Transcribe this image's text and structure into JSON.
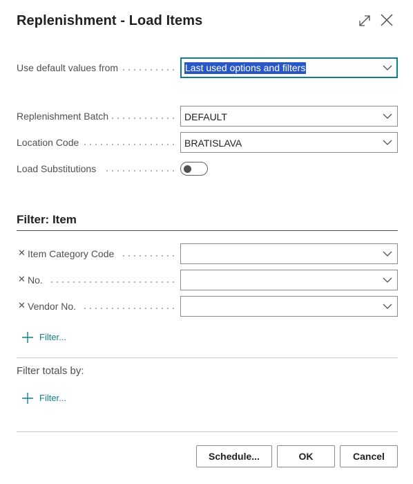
{
  "dialog": {
    "title": "Replenishment - Load Items",
    "expand_icon": "expand-diagonal-icon",
    "close_icon": "close-icon"
  },
  "options": {
    "default_values": {
      "label": "Use default values from",
      "value": "Last used options and filters"
    },
    "batch": {
      "label": "Replenishment Batch",
      "value": "DEFAULT"
    },
    "location": {
      "label": "Location Code",
      "value": "BRATISLAVA"
    },
    "substitutions": {
      "label": "Load Substitutions",
      "enabled": false
    }
  },
  "item_filter": {
    "title": "Filter: Item",
    "fields": [
      {
        "label": "Item Category Code",
        "value": ""
      },
      {
        "label": "No.",
        "value": ""
      },
      {
        "label": "Vendor No.",
        "value": ""
      }
    ],
    "add_filter_label": "Filter..."
  },
  "filter_totals": {
    "title": "Filter totals by:",
    "add_filter_label": "Filter..."
  },
  "footer": {
    "schedule_label": "Schedule...",
    "ok_label": "OK",
    "cancel_label": "Cancel"
  },
  "colors": {
    "accent": "#0e7f88",
    "selection": "#2a57c6"
  }
}
